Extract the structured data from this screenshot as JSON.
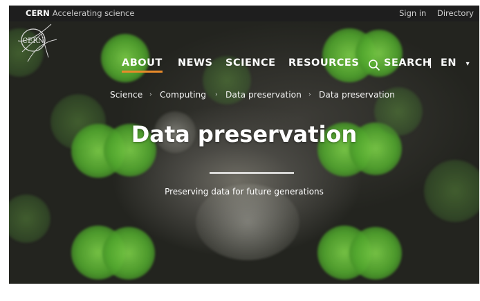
{
  "topbar": {
    "brand": "CERN",
    "tagline": "Accelerating science",
    "sign_in": "Sign in",
    "directory": "Directory"
  },
  "logo": {
    "text": "CERN"
  },
  "nav": {
    "items": [
      {
        "label": "ABOUT",
        "active": true
      },
      {
        "label": "NEWS"
      },
      {
        "label": "SCIENCE"
      },
      {
        "label": "RESOURCES"
      }
    ],
    "search_label": "SEARCH",
    "separator": "|",
    "language": "EN",
    "language_caret": "▾"
  },
  "breadcrumb": {
    "items": [
      "Science",
      "Computing",
      "Data preservation",
      "Data preservation"
    ],
    "separator": "›"
  },
  "hero": {
    "title": "Data preservation",
    "subtitle": "Preserving data for future generations"
  },
  "colors": {
    "accent": "#e98b2a",
    "topbar_bg": "#1e1e1e",
    "bokeh_green": "#5aa52d"
  },
  "icons": [
    "cern-logo-icon",
    "search-icon",
    "chevron-down-icon",
    "breadcrumb-separator-icon"
  ]
}
